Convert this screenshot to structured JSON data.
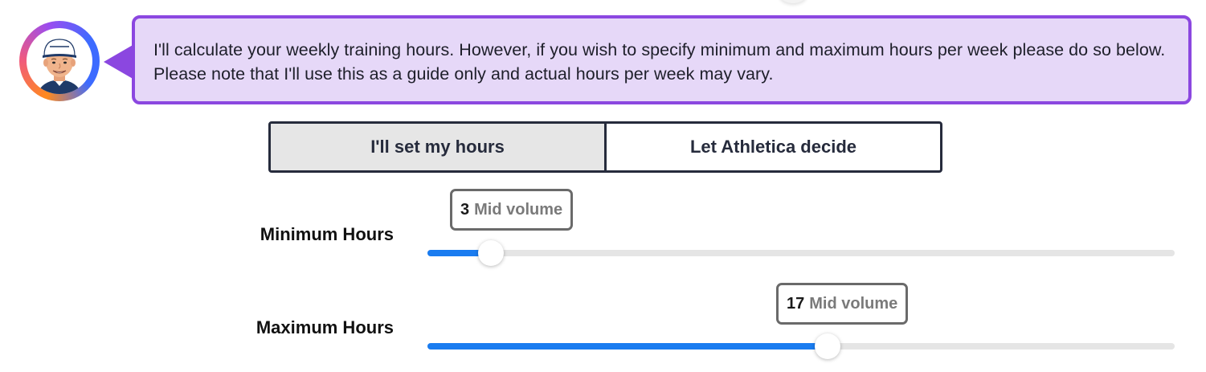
{
  "coach": {
    "message": "I'll calculate your weekly training hours. However, if you wish to specify minimum and maximum hours per week please do so below. Please note that I'll use this as a guide only and actual hours per week may vary."
  },
  "hours_mode": {
    "options": [
      "I'll set my hours",
      "Let Athletica decide"
    ],
    "selected": "I'll set my hours"
  },
  "sliders": {
    "minimum": {
      "label": "Minimum Hours",
      "value": "3",
      "volume": "Mid volume",
      "fill_percent": 8.5
    },
    "maximum": {
      "label": "Maximum Hours",
      "value": "17",
      "volume": "Mid volume",
      "fill_percent": 53.5
    }
  },
  "colors": {
    "accent_purple": "#8b47e0",
    "bubble_bg": "#e6d8f8",
    "slider_fill": "#1a7cf0",
    "toggle_border": "#262b3c"
  }
}
